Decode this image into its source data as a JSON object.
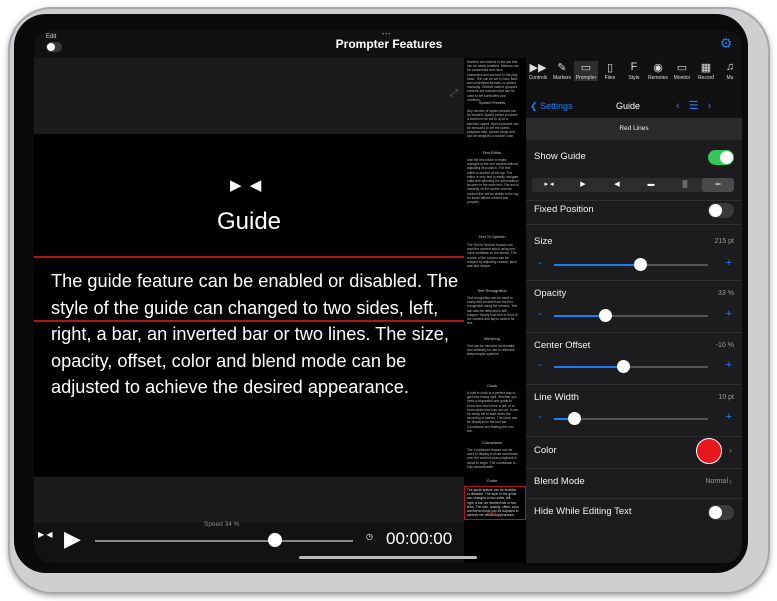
{
  "app": {
    "title": "Prompter Features",
    "edit_label": "Edit",
    "grabber": "•••"
  },
  "prompter": {
    "arrows": "▶ ◀",
    "heading": "Guide",
    "body": "The guide feature can be enabled or disabled. The style of the guide can changed to two sides, left, right, a bar, an inverted bar or two lines. The size, opacity, offset, color and blend mode can be adjusted to achieve the desired appearance."
  },
  "transport": {
    "speed_label": "Speed  34 %",
    "time": "00:00:00",
    "speed_value": 34
  },
  "mini": {
    "blocks": [
      {
        "text": "Markers are buttons in the bar that can be easily enabled. Markers can be customized and have characters and connect to the play head. Text can be set in bold, italic and underlined formats, or added manually. Several marker grouped controls are included that can be used to set controllers and monitors."
      },
      {
        "label": "Speed Presets",
        "text": "Any number of speed presets can be created. Speed preset provides a control to be set to up to a selected speed. Speed presets can be executed to set the speed, playback step, spread range and can be assigned a custom color."
      },
      {
        "label": "Text Editor",
        "text": "Use the text editor to make changes to the text content without adjusting its position. The text editor is docked at the top. The editor is very fast to easily navigate edits with affecting the presentation as seen in the main text. The text is instantly on the screen and the content line will be visible in the top for those before content and properly."
      },
      {
        "label": "Text To Speech",
        "text": "The Text to Speech feature can read the content aloud using one voice available on the device. The source of the content can be relayed by adjusting volume, pitch rate and delays."
      },
      {
        "label": "Text Recognition",
        "text": "Text recognition can be used to easily add content from the text recognition using the camera. Text can also be detected in still images. Simply hold text in front of the camera and tap to search for text."
      },
      {
        "label": "Mirroring",
        "text": "Text can be mirrored horizontally and vertically for use in reflective teleprompter systems."
      },
      {
        "label": "Clock",
        "text": "A built in clock is a perfect way to get lines timing right. Whether you need a stopwatch and guide to know how much time is left, or to know when time has run out. It can be easily set to start when the recording is started. The clock can be displayed in the tool bar. Countdown and floating the tool bar."
      },
      {
        "label": "Countdown",
        "text": "The Countdown feature can be used to display a visual countdown over the content when playback is about to begin. The countdown is fully customizable."
      },
      {
        "label": "Guide",
        "text": "The guide feature can be enabled or disabled. The style of the guide can changed to two sides, left, right, a bar, an inverted bar or two lines. The size, opacity, offset, color and blend mode can be adjusted to achieve the desired appearance.",
        "pct": "83%"
      }
    ]
  },
  "toolbar": {
    "items": [
      {
        "label": "Controls",
        "icon": "▶▶"
      },
      {
        "label": "Markers",
        "icon": "✎"
      },
      {
        "label": "Prompter",
        "icon": "▭"
      },
      {
        "label": "Files",
        "icon": "▯"
      },
      {
        "label": "Style",
        "icon": "F"
      },
      {
        "label": "Remotes",
        "icon": "◉"
      },
      {
        "label": "Monitor",
        "icon": "▭"
      },
      {
        "label": "Record",
        "icon": "▦"
      },
      {
        "label": "Mu",
        "icon": "♫"
      }
    ]
  },
  "nav": {
    "back": "Settings",
    "title": "Guide"
  },
  "section": {
    "title": "Red Lines"
  },
  "settings": {
    "show_guide": {
      "label": "Show Guide",
      "on": true
    },
    "fixed_position": {
      "label": "Fixed Position",
      "on": false
    },
    "size": {
      "label": "Size",
      "value": "215 pt",
      "fraction": 0.56
    },
    "opacity": {
      "label": "Opacity",
      "value": "33 %",
      "fraction": 0.33
    },
    "center_offset": {
      "label": "Center Offset",
      "value": "-10 %",
      "fraction": 0.45
    },
    "line_width": {
      "label": "Line Width",
      "value": "10 pt",
      "fraction": 0.13
    },
    "color": {
      "label": "Color",
      "hex": "#e8171d"
    },
    "blend_mode": {
      "label": "Blend Mode",
      "value": "Normal"
    },
    "hide_while_editing": {
      "label": "Hide While Editing Text",
      "on": false
    }
  },
  "colors": {
    "accent": "#1f7cf7",
    "guide_red": "#b2161c",
    "toggle_on": "#34c759"
  }
}
